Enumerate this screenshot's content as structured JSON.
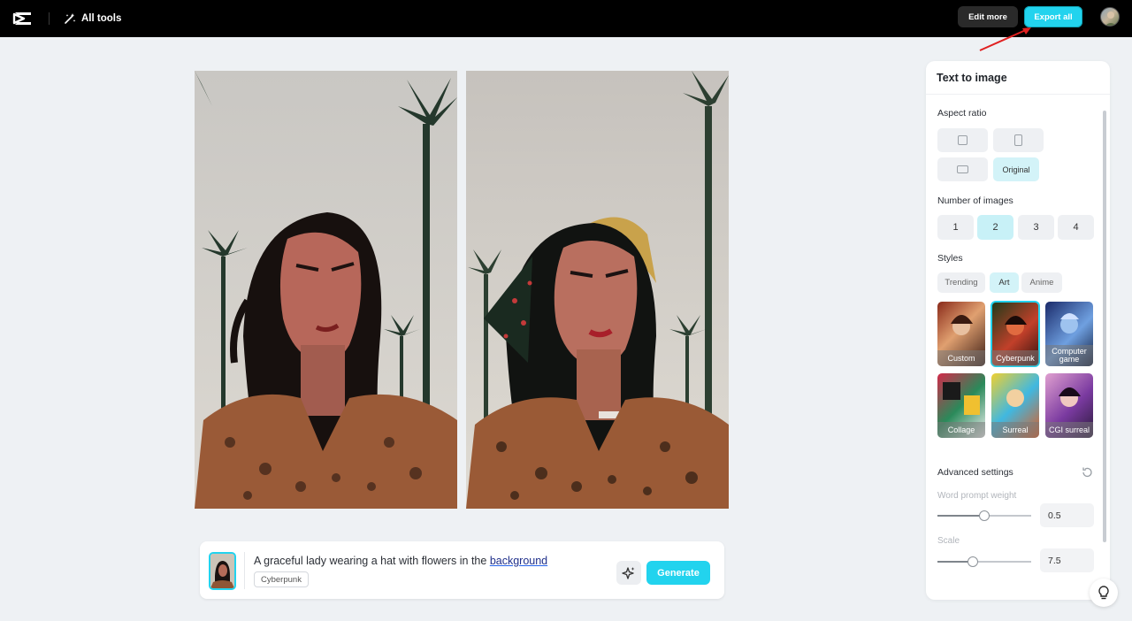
{
  "topbar": {
    "logo": "capcut-logo",
    "all_tools_label": "All tools",
    "edit_more_label": "Edit more",
    "export_all_label": "Export all"
  },
  "prompt": {
    "text_main": "A graceful lady wearing a hat with flowers in the ",
    "text_underlined": "background",
    "style_chip": "Cyberpunk",
    "generate_label": "Generate"
  },
  "panel": {
    "title": "Text to image",
    "aspect_ratio_label": "Aspect ratio",
    "aspect_options": [
      {
        "icon": "square-ratio-icon",
        "label": ""
      },
      {
        "icon": "portrait-ratio-icon",
        "label": ""
      },
      {
        "icon": "landscape-ratio-icon",
        "label": ""
      },
      {
        "icon": "",
        "label": "Original"
      }
    ],
    "aspect_selected": "Original",
    "num_images_label": "Number of images",
    "num_options": [
      "1",
      "2",
      "3",
      "4"
    ],
    "num_selected": "2",
    "styles_label": "Styles",
    "style_tabs": [
      "Trending",
      "Art",
      "Anime"
    ],
    "style_tab_selected": "Art",
    "style_cards": [
      "Custom",
      "Cyberpunk",
      "Computer game",
      "Collage",
      "Surreal",
      "CGI surreal"
    ],
    "style_selected": "Cyberpunk",
    "advanced_label": "Advanced settings",
    "word_weight_label": "Word prompt weight",
    "word_weight_value": "0.5",
    "scale_label": "Scale",
    "scale_value": "7.5"
  },
  "colors": {
    "accent": "#22d3ee",
    "topbar": "#000000",
    "annotation_arrow": "#e02020"
  }
}
